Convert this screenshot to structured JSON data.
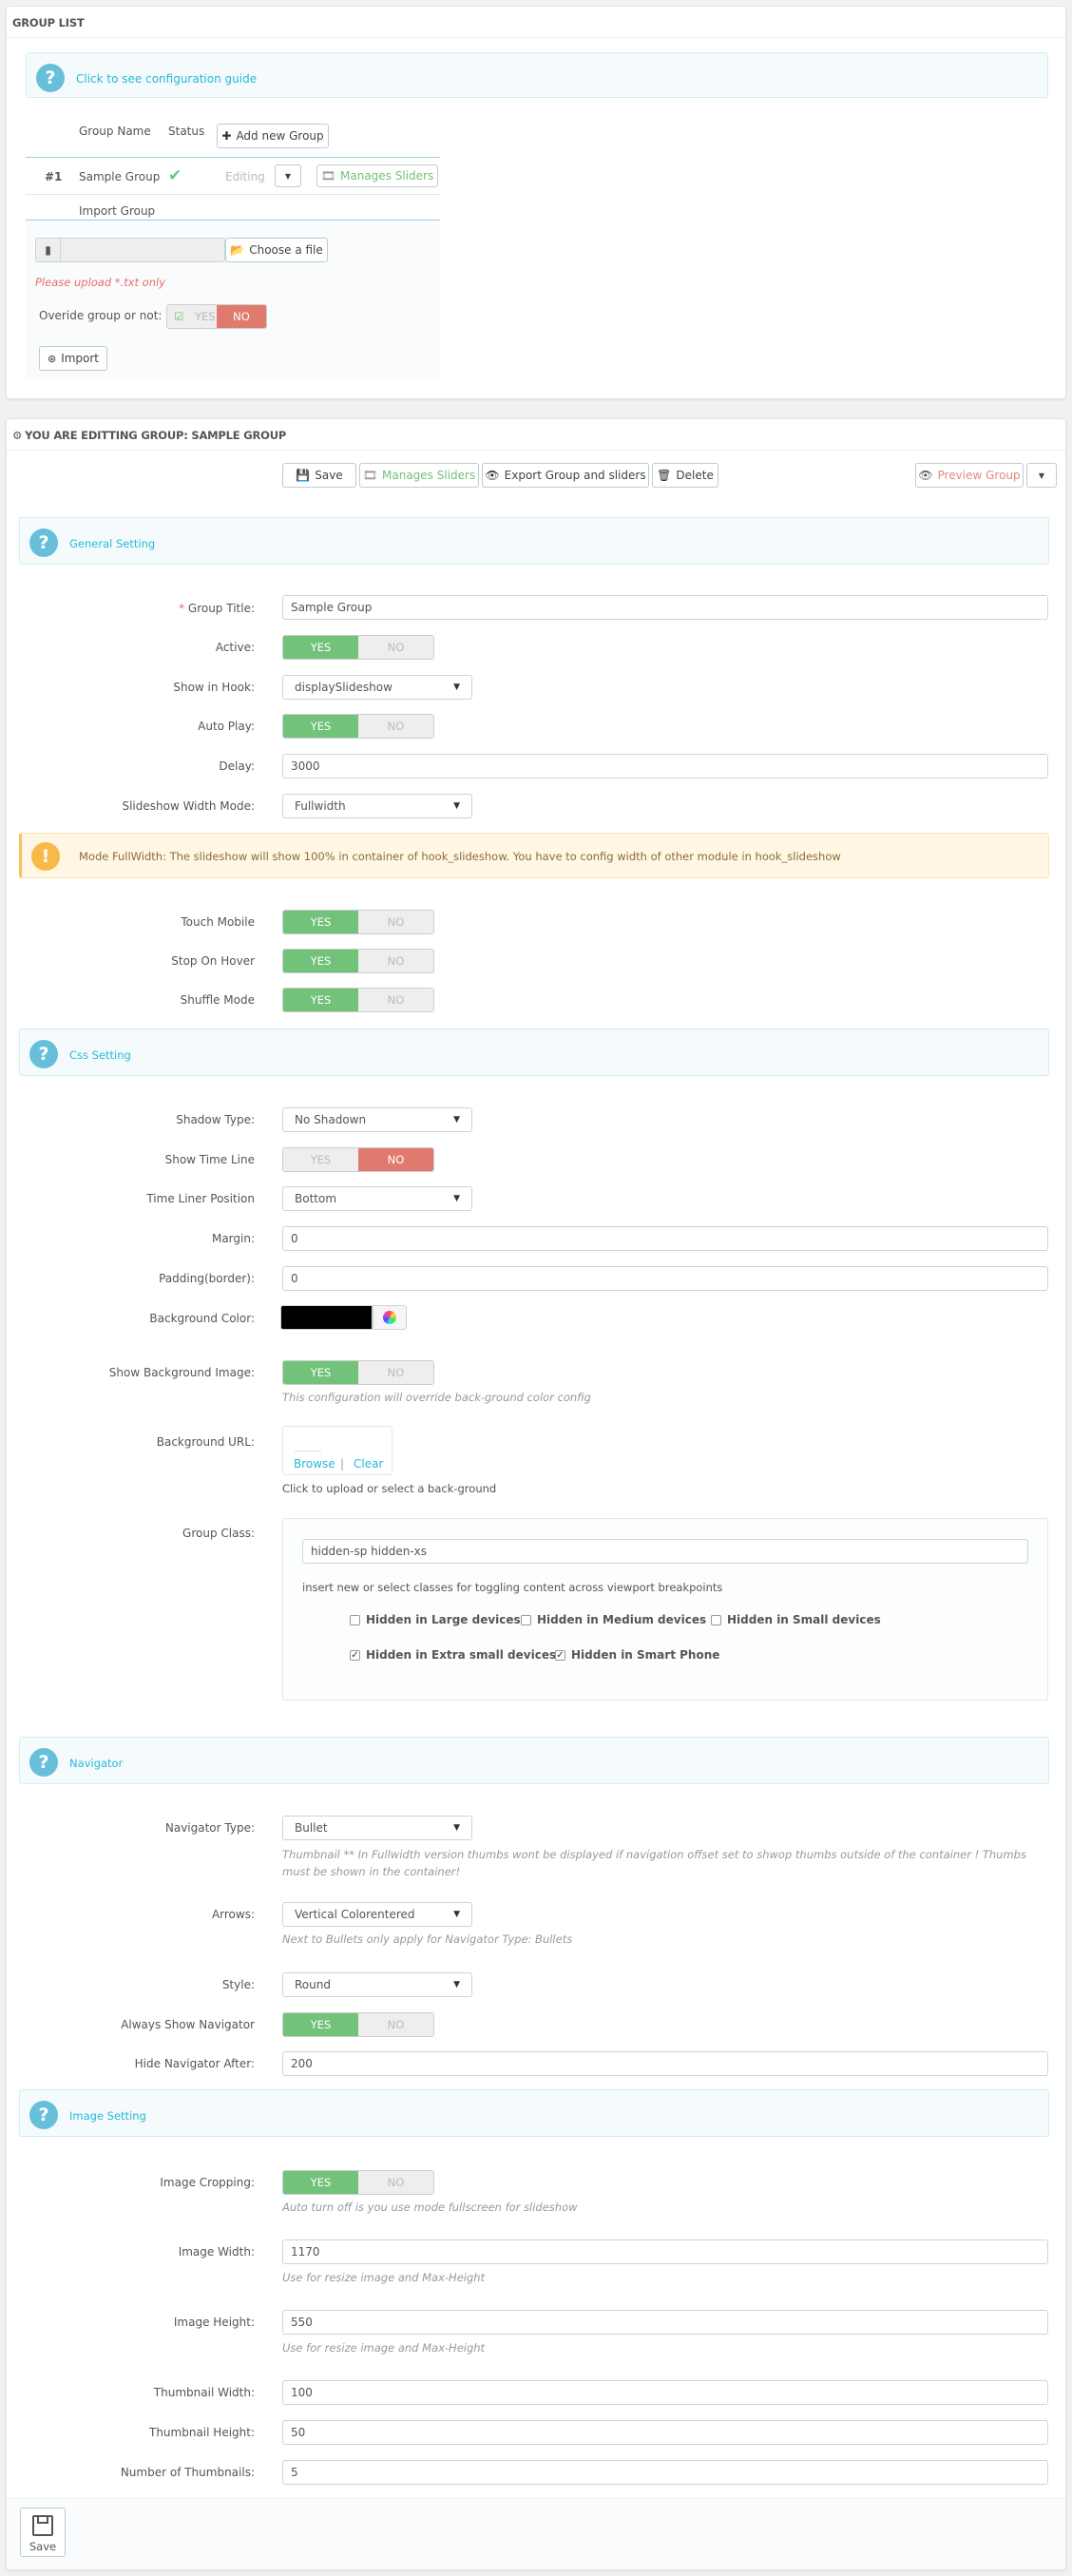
{
  "group_list": {
    "title": "GROUP LIST",
    "guide_link": "Click to see configuration guide",
    "col_group_name": "Group Name",
    "col_status": "Status",
    "add_group_btn": "Add new Group",
    "row": {
      "num": "#1",
      "name": "Sample Group",
      "status_icon": "check-icon",
      "editing": "Editing",
      "manages_sliders": "Manages Sliders"
    },
    "import_group_label": "Import Group",
    "choose_file_btn": "Choose a file",
    "upload_hint": "Please upload *.txt only",
    "override_label": "Overide group or not:",
    "override_yes": "YES",
    "override_no": "NO",
    "import_btn": "Import"
  },
  "edit": {
    "title": "YOU ARE EDITTING GROUP: SAMPLE GROUP",
    "toolbar": {
      "save": "Save",
      "manages_sliders": "Manages Sliders",
      "export": "Export Group and sliders",
      "delete": "Delete",
      "preview": "Preview Group"
    },
    "sections": {
      "general": "General Setting",
      "css": "Css Setting",
      "navigator": "Navigator",
      "image": "Image Setting"
    },
    "yes": "YES",
    "no": "NO",
    "fields": {
      "group_title_label": "Group Title:",
      "group_title_value": "Sample Group",
      "active_label": "Active:",
      "show_in_hook_label": "Show in Hook:",
      "show_in_hook_value": "displaySlideshow",
      "auto_play_label": "Auto Play:",
      "delay_label": "Delay:",
      "delay_value": "3000",
      "width_mode_label": "Slideshow Width Mode:",
      "width_mode_value": "Fullwidth",
      "width_warning": "Mode FullWidth: The slideshow will show 100% in container of hook_slideshow. You have to config width of other module in hook_slideshow",
      "touch_mobile_label": "Touch Mobile",
      "stop_hover_label": "Stop On Hover",
      "shuffle_label": "Shuffle Mode",
      "shadow_type_label": "Shadow Type:",
      "shadow_type_value": "No Shadown",
      "show_timeline_label": "Show Time Line",
      "timeliner_pos_label": "Time Liner Position",
      "timeliner_pos_value": "Bottom",
      "margin_label": "Margin:",
      "margin_value": "0",
      "padding_label": "Padding(border):",
      "padding_value": "0",
      "bg_color_label": "Background Color:",
      "bg_color_value": "#000000",
      "show_bg_image_label": "Show Background Image:",
      "show_bg_image_help": "This configuration will override back-ground color config",
      "bg_url_label": "Background URL:",
      "browse": "Browse",
      "sep": "|",
      "clear": "Clear",
      "bg_url_help": "Click to upload or select a back-ground",
      "group_class_label": "Group Class:",
      "group_class_value": "hidden-sp hidden-xs",
      "group_class_help": "insert new or select classes for toggling content across viewport breakpoints",
      "hidden_large": "Hidden in Large devices",
      "hidden_medium": "Hidden in Medium devices",
      "hidden_small": "Hidden in Small devices",
      "hidden_xsmall": "Hidden in Extra small devices",
      "hidden_phone": "Hidden in Smart Phone",
      "nav_type_label": "Navigator Type:",
      "nav_type_value": "Bullet",
      "nav_type_help": "Thumbnail ** In Fullwidth version thumbs wont be displayed if navigation offset set to shwop thumbs outside of the container ! Thumbs must be shown in the container!",
      "arrows_label": "Arrows:",
      "arrows_value": "Vertical Colorentered",
      "arrows_help": "Next to Bullets only apply for Navigator Type: Bullets",
      "style_label": "Style:",
      "style_value": "Round",
      "always_nav_label": "Always Show Navigator",
      "hide_nav_label": "Hide Navigator After:",
      "hide_nav_value": "200",
      "image_crop_label": "Image Cropping:",
      "image_crop_help": "Auto turn off is you use mode fullscreen for slideshow",
      "image_width_label": "Image Width:",
      "image_width_value": "1170",
      "image_width_help": "Use for resize image and Max-Height",
      "image_height_label": "Image Height:",
      "image_height_value": "550",
      "image_height_help": "Use for resize image and Max-Height",
      "thumb_width_label": "Thumbnail Width:",
      "thumb_width_value": "100",
      "thumb_height_label": "Thumbnail Height:",
      "thumb_height_value": "50",
      "num_thumbs_label": "Number of Thumbnails:",
      "num_thumbs_value": "5"
    },
    "footer_save": "Save"
  }
}
